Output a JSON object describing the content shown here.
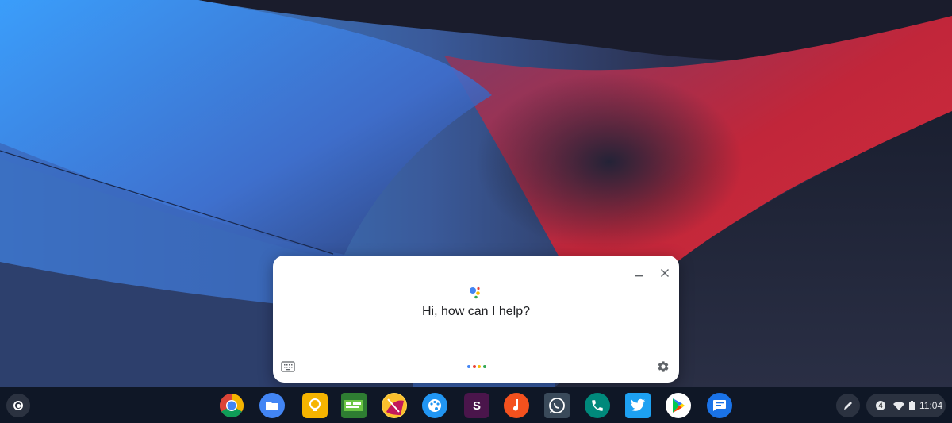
{
  "assistant": {
    "greeting": "Hi, how can I help?",
    "minimize_icon": "minimize-icon",
    "close_icon": "close-icon",
    "keyboard_icon": "keyboard-icon",
    "settings_icon": "gear-icon",
    "dot_colors": [
      "#4285f4",
      "#ea4335",
      "#fbbc05",
      "#34a853"
    ]
  },
  "shelf": {
    "apps": [
      {
        "name": "chrome"
      },
      {
        "name": "files"
      },
      {
        "name": "keep"
      },
      {
        "name": "duolingo"
      },
      {
        "name": "google-earth"
      },
      {
        "name": "chrome-canvas"
      },
      {
        "name": "slack",
        "label": "S"
      },
      {
        "name": "music"
      },
      {
        "name": "whatsapp"
      },
      {
        "name": "phone"
      },
      {
        "name": "twitter"
      },
      {
        "name": "play-store"
      },
      {
        "name": "messages"
      }
    ],
    "tray": {
      "notification_count": "4",
      "time": "11:04"
    }
  }
}
